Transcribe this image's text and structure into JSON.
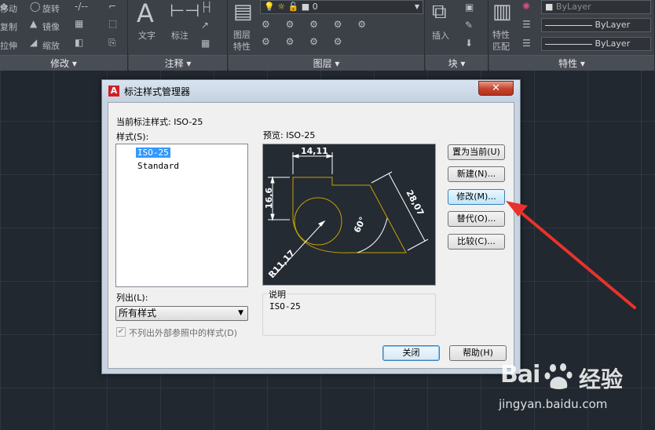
{
  "ribbon": {
    "modify_items": [
      "移动",
      "旋转",
      "复制",
      "镜像",
      "拉伸",
      "缩放"
    ],
    "text_label": "文字",
    "dimension_label": "标注",
    "layer_props_label": "图层特性",
    "layer_combo_value": "0",
    "insert_label": "插入",
    "match_props_label": "特性匹配",
    "bylayer_values": [
      "ByLayer",
      "ByLayer",
      "ByLayer"
    ],
    "panels": [
      "修改 ▾",
      "注释 ▾",
      "图层 ▾",
      "块 ▾",
      "特性 ▾"
    ]
  },
  "dialog": {
    "title": "标注样式管理器",
    "current_style_label": "当前标注样式: ISO-25",
    "styles_label": "样式(S):",
    "styles": [
      "ISO-25",
      "Standard"
    ],
    "preview_label": "预览: ISO-25",
    "list_label": "列出(L):",
    "list_value": "所有样式",
    "checkbox_label": "不列出外部参照中的样式(D)",
    "description_label": "说明",
    "description_text": "ISO-25",
    "buttons": {
      "set_current": "置为当前(U)",
      "new": "新建(N)...",
      "modify": "修改(M)...",
      "override": "替代(O)...",
      "compare": "比较(C)...",
      "close": "关闭",
      "help": "帮助(H)"
    },
    "preview_dims": {
      "top": "14,11",
      "left": "16,6",
      "right": "28,07",
      "angle": "60°",
      "radius": "R11,17"
    }
  },
  "watermark": {
    "brand": "Bai",
    "brand_cn": "经验",
    "url": "jingyan.baidu.com"
  },
  "colors": {
    "accent": "#3399ff",
    "arrow": "#e8322b",
    "preview_bg": "#242b33",
    "preview_geometry": "#c8a000"
  }
}
